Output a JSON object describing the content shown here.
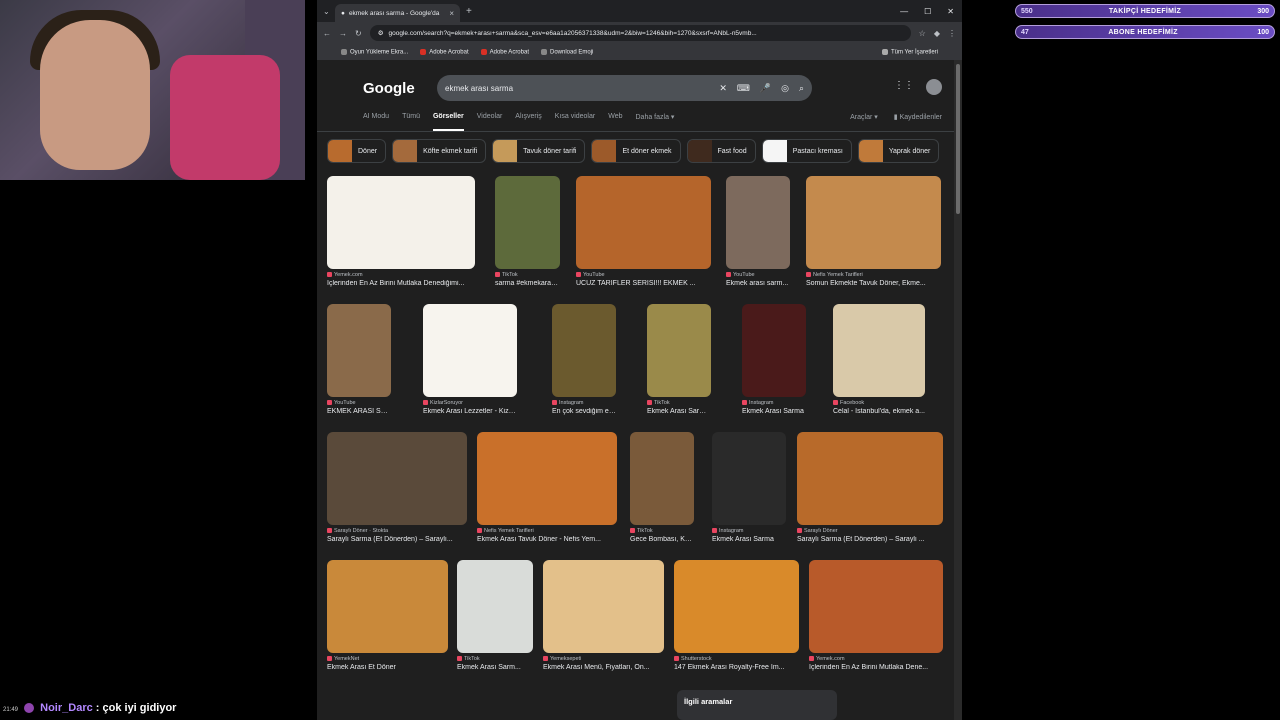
{
  "browser": {
    "tab_title": "ekmek arası sarma - Google'da",
    "url": "google.com/search?q=ekmek+arası+sarma&sca_esv=e6aa1a2056371338&udm=2&biw=1246&bih=1270&sxsrf=ANbL-n5vmb...",
    "bookmarks": [
      "Oyun Yükleme Ekra...",
      "Adobe Acrobat",
      "Adobe Acrobat",
      "Download Emoji"
    ],
    "all_bookmarks": "Tüm Yer İşaretleri"
  },
  "google": {
    "logo": "Google",
    "query": "ekmek arası sarma",
    "nav": [
      "AI Modu",
      "Tümü",
      "Görseller",
      "Videolar",
      "Alışveriş",
      "Kısa videolar",
      "Web",
      "Daha fazla ▾"
    ],
    "tools": "Araçlar ▾",
    "saved": "Kaydedilenler",
    "chips": [
      {
        "label": "Döner",
        "color": "#b86b2e"
      },
      {
        "label": "Köfte ekmek tarifi",
        "color": "#a46a3c"
      },
      {
        "label": "Tavuk döner tarifi",
        "color": "#c59a5a"
      },
      {
        "label": "Et döner ekmek",
        "color": "#9c5a2a"
      },
      {
        "label": "Fast food",
        "color": "#3f2a1e"
      },
      {
        "label": "Pastacı kreması",
        "color": "#f5f5f5"
      },
      {
        "label": "Yaprak döner",
        "color": "#c07a3a"
      }
    ],
    "rows": [
      [
        {
          "source": "Yemek.com",
          "caption": "İçlerinden En Az Birini Mutlaka Denediğimi...",
          "color": "#f4f1ea"
        },
        {
          "source": "TikTok",
          "caption": "sarma #ekmekaras...",
          "color": "#5d6a3b"
        },
        {
          "source": "YouTube",
          "caption": "UCUZ TARİFLER SERİSİ!!! EKMEK ...",
          "color": "#b5652b"
        },
        {
          "source": "YouTube",
          "caption": "Ekmek arası sarm...",
          "color": "#7d6a5d"
        },
        {
          "source": "Nefis Yemek Tarifleri",
          "caption": "Somun Ekmekte Tavuk Döner, Ekme...",
          "color": "#c48a4d"
        }
      ],
      [
        {
          "source": "YouTube",
          "caption": "EKMEK ARASI SAR...",
          "color": "#8a6a4a"
        },
        {
          "source": "KizlarSoruyor",
          "caption": "Ekmek Arası Lezzetler - KizlarSo...",
          "color": "#f7f4ee"
        },
        {
          "source": "Instagram",
          "caption": "En çok sevdiğim ekm...",
          "color": "#6b5a2e"
        },
        {
          "source": "TikTok",
          "caption": "Ekmek Arası Sarma | ...",
          "color": "#9a8a4a"
        },
        {
          "source": "Instagram",
          "caption": "Ekmek Arası Sarma",
          "color": "#4a1a1a"
        },
        {
          "source": "Facebook",
          "caption": "Celal - İstanbul'da, ekmek a...",
          "color": "#d9c9a9"
        }
      ],
      [
        {
          "source": "Saraylı Döner · Stokta",
          "caption": "Saraylı Sarma (Et Dönerden) – Saraylı...",
          "color": "#5a4a3a"
        },
        {
          "source": "Nefis Yemek Tarifleri",
          "caption": "Ekmek Arası Tavuk Döner - Nefis Yem...",
          "color": "#c9702a"
        },
        {
          "source": "TikTok",
          "caption": "Gece Bombası, Kö...",
          "color": "#7a5a3a"
        },
        {
          "source": "Instagram",
          "caption": "Ekmek Arası Sarma",
          "color": "#2a2a2a"
        },
        {
          "source": "Saraylı Döner",
          "caption": "Saraylı Sarma (Et Dönerden) – Saraylı ...",
          "color": "#b86a2a"
        }
      ],
      [
        {
          "source": "YemekNet",
          "caption": "Ekmek Arası Et Döner",
          "color": "#c9893a"
        },
        {
          "source": "TikTok",
          "caption": "Ekmek Arası Sarm...",
          "color": "#d9dcd9"
        },
        {
          "source": "Yemeksepeti",
          "caption": "Ekmek Arası Menü, Fiyatları, On...",
          "color": "#e3c08a"
        },
        {
          "source": "Shutterstock",
          "caption": "147 Ekmek Arası Royalty-Free Im...",
          "color": "#d98a2a"
        },
        {
          "source": "Yemek.com",
          "caption": "İçlerinden En Az Birini Mutlaka Dene...",
          "color": "#b85a2a"
        }
      ]
    ],
    "related": "İlgili aramalar"
  },
  "overlay": {
    "goal1": {
      "low": "550",
      "title": "TAKİPÇİ HEDEFİMİZ",
      "high": "300"
    },
    "goal2": {
      "low": "47",
      "title": "ABONE HEDEFİMİZ",
      "high": "100"
    },
    "chat": {
      "time": "21:49",
      "nick": "Noir_Darc",
      "message": ": çok iyi gidiyor"
    }
  }
}
